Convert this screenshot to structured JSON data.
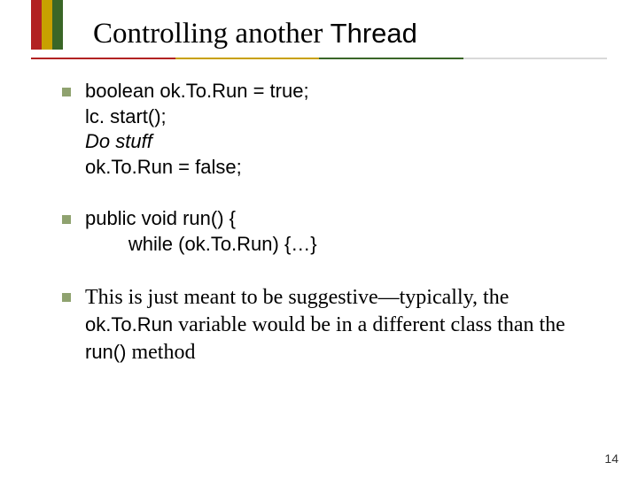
{
  "accent_colors": [
    "#b22222",
    "#c8a000",
    "#3a6627"
  ],
  "rule_colors": [
    "#b22222",
    "#c8a000",
    "#3a6627",
    "#d9d9d9"
  ],
  "title": {
    "serif_part": "Controlling another ",
    "mono_part": "Thread"
  },
  "bullets": [
    {
      "lines": [
        {
          "text": "boolean ok.To.Run = true;",
          "style": "code"
        },
        {
          "text": "lc. start();",
          "style": "code"
        },
        {
          "text": "Do stuff",
          "style": "ital-code"
        },
        {
          "text": "ok.To.Run = false;",
          "style": "code"
        }
      ]
    },
    {
      "lines": [
        {
          "text": "public void run() {",
          "style": "code"
        },
        {
          "text": "        while (ok.To.Run) {…}",
          "style": "code"
        }
      ]
    },
    {
      "mixed": [
        {
          "text": "This is just meant to be suggestive—typically, the ",
          "style": "serif"
        },
        {
          "text": "ok.To.Run",
          "style": "code"
        },
        {
          "text": " variable would be in a different class than the ",
          "style": "serif"
        },
        {
          "text": "run()",
          "style": "code"
        },
        {
          "text": " method",
          "style": "serif"
        }
      ]
    }
  ],
  "page_number": "14"
}
